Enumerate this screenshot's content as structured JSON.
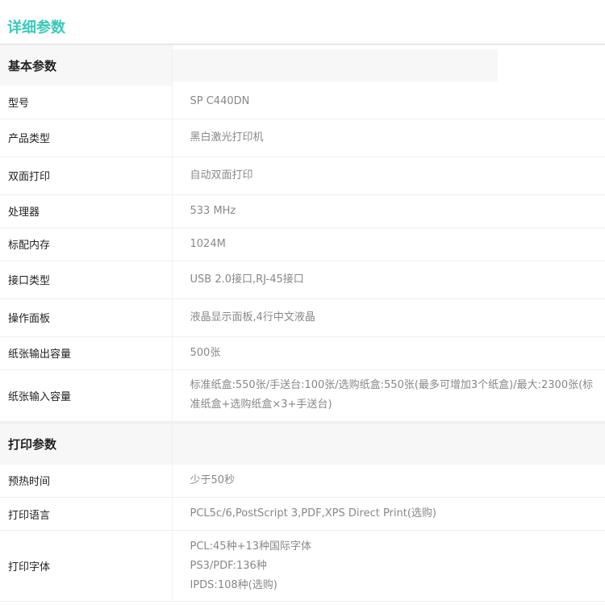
{
  "page": {
    "title": "详细参数"
  },
  "sections": [
    {
      "title": "基本参数",
      "rows": [
        {
          "label": "型号",
          "value": "SP C440DN"
        },
        {
          "label": "产品类型",
          "value": "黑白激光打印机"
        },
        {
          "label": "双面打印",
          "value": "自动双面打印"
        },
        {
          "label": "处理器",
          "value": "533 MHz"
        },
        {
          "label": "标配内存",
          "value": "1024M"
        },
        {
          "label": "接口类型",
          "value": "USB 2.0接口,RJ-45接口"
        },
        {
          "label": "操作面板",
          "value": "液晶显示面板,4行中文液晶"
        },
        {
          "label": "纸张输出容量",
          "value": "500张"
        },
        {
          "label": "纸张输入容量",
          "value": "标准纸盒:550张/手送台:100张/选购纸盒:550张(最多可增加3个纸盒)/最大:2300张(标准纸盒+选购纸盒×3+手送台)"
        }
      ]
    },
    {
      "title": "打印参数",
      "rows": [
        {
          "label": "预热时间",
          "value": "少于50秒"
        },
        {
          "label": "打印语言",
          "value": "PCL5c/6,PostScript 3,PDF,XPS Direct Print(选购)"
        },
        {
          "label": "打印字体",
          "lines": [
            "PCL:45种+13种国际字体",
            "PS3/PDF:136种",
            "IPDS:108种(选购)"
          ]
        }
      ]
    }
  ]
}
